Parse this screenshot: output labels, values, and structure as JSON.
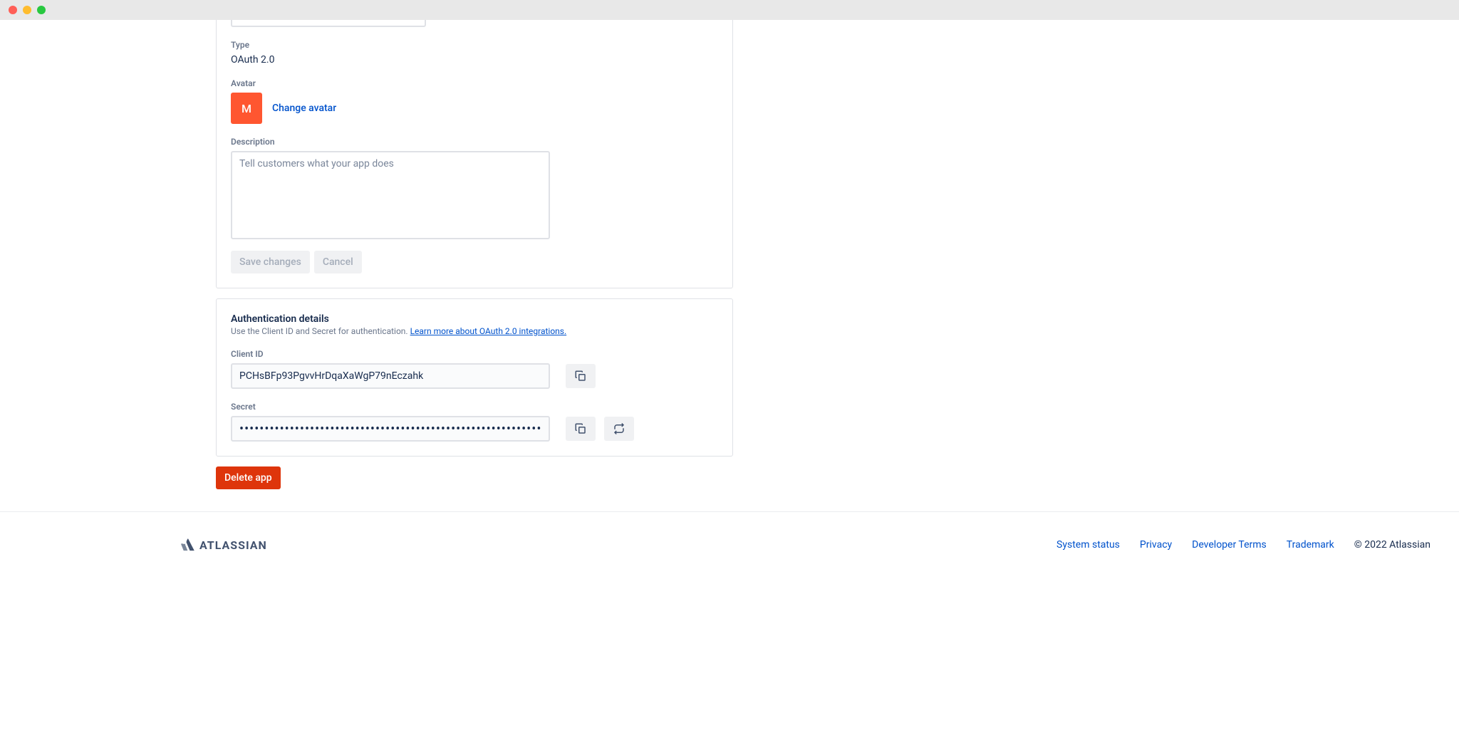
{
  "settings": {
    "type_label": "Type",
    "type_value": "OAuth 2.0",
    "avatar_label": "Avatar",
    "avatar_letter": "M",
    "change_avatar_label": "Change avatar",
    "description_label": "Description",
    "description_placeholder": "Tell customers what your app does",
    "description_value": "",
    "save_label": "Save changes",
    "cancel_label": "Cancel"
  },
  "auth": {
    "heading": "Authentication details",
    "subtext": "Use the Client ID and Secret for authentication. ",
    "learn_more": "Learn more about OAuth 2.0 integrations.",
    "client_id_label": "Client ID",
    "client_id_value": "PCHsBFp93PgvvHrDqaXaWgP79nEczahk",
    "secret_label": "Secret",
    "secret_value": "••••••••••••••••••••••••••••••••••••••••••••••••••••••••••••••••"
  },
  "delete": {
    "label": "Delete app"
  },
  "footer": {
    "brand": "ATLASSIAN",
    "links": {
      "status": "System status",
      "privacy": "Privacy",
      "terms": "Developer Terms",
      "trademark": "Trademark"
    },
    "copyright": "© 2022 Atlassian"
  }
}
